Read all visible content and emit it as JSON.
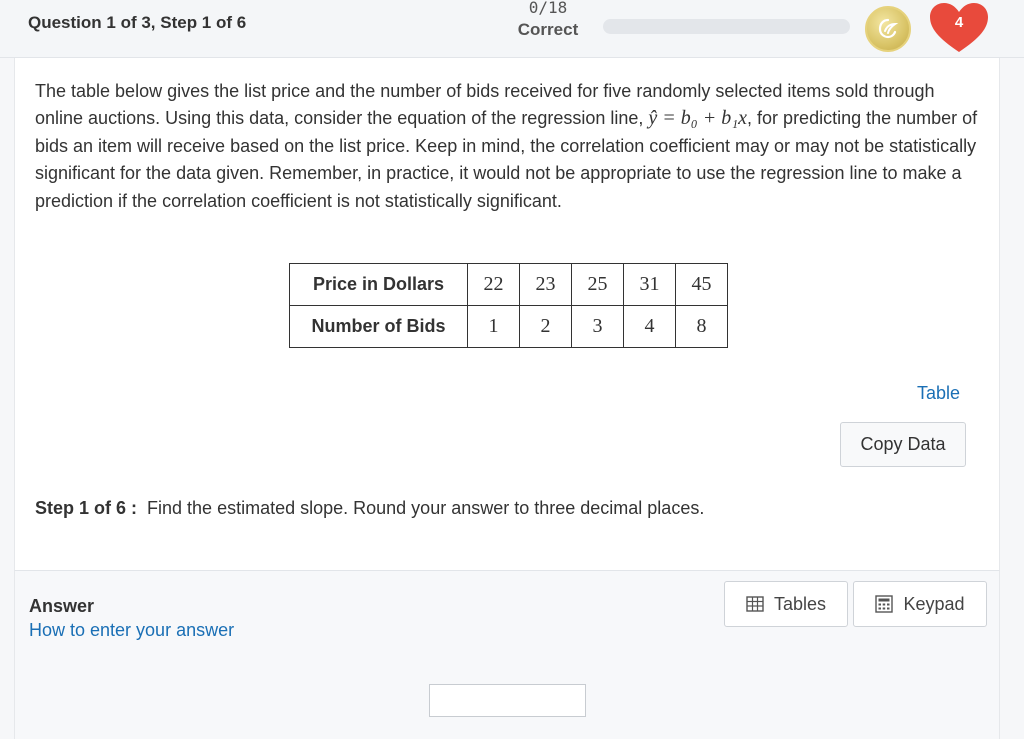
{
  "header": {
    "question_title": "Question 1 of 3, Step 1 of 6",
    "score_value": "0/18",
    "score_label": "Correct",
    "progress_fraction": 0,
    "lives": "4"
  },
  "problem": {
    "text_before_math": "The table below gives the list price and the number of bids received for five randomly selected items sold through online auctions. Using this data, consider the equation of the regression line, ",
    "equation": "ŷ = b₀ + b₁x",
    "text_after_math": ", for predicting the number of bids an item will receive based on the list price. Keep in mind, the correlation coefficient may or may not be statistically significant for the data given. Remember, in practice, it would not be appropriate to use the regression line to make a prediction if the correlation coefficient is not statistically significant."
  },
  "data_table": {
    "rows": [
      {
        "header": "Price in Dollars",
        "values": [
          "22",
          "23",
          "25",
          "31",
          "45"
        ]
      },
      {
        "header": "Number of Bids",
        "values": [
          "1",
          "2",
          "3",
          "4",
          "8"
        ]
      }
    ]
  },
  "actions": {
    "table_link": "Table",
    "copy_data": "Copy Data"
  },
  "step": {
    "label": "Step 1 of 6 :",
    "instruction": "Find the estimated slope. Round your answer to three decimal places."
  },
  "answer": {
    "label": "Answer",
    "help_link": "How to enter your answer",
    "tables_button": "Tables",
    "keypad_button": "Keypad",
    "input_value": ""
  },
  "colors": {
    "link": "#1a6fb5",
    "heart": "#e84a3c",
    "coin": "#d9c467"
  }
}
